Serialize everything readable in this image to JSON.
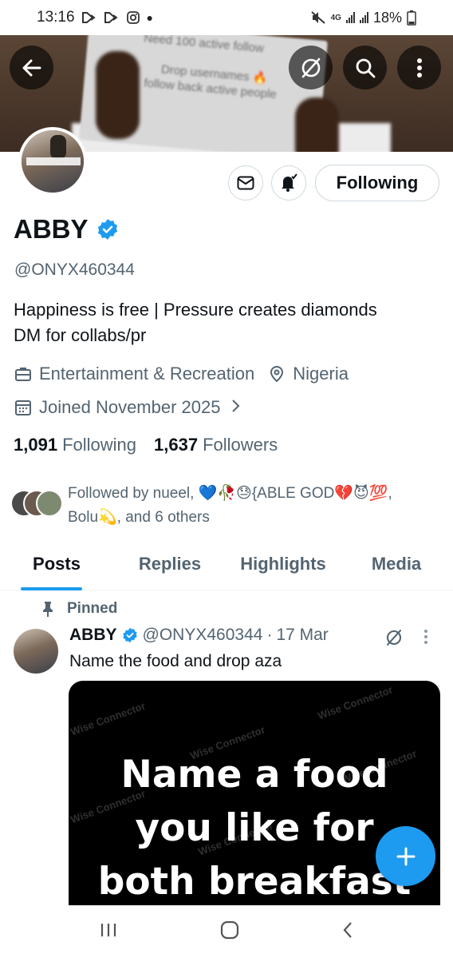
{
  "status_bar": {
    "time": "13:16",
    "battery": "18%",
    "network": "4G"
  },
  "banner": {
    "sign_line_1": "Need 100 active follow",
    "sign_line_2": "Drop usernames 🔥",
    "sign_line_3": "follow back active people"
  },
  "profile": {
    "display_name": "ABBY",
    "handle": "@ONYX460344",
    "bio_line_1": "Happiness is free | Pressure creates diamonds",
    "bio_line_2": "DM for collabs/pr",
    "category": "Entertainment & Recreation",
    "location": "Nigeria",
    "joined": "Joined November 2025",
    "following_count": "1,091",
    "following_label": "Following",
    "followers_count": "1,637",
    "followers_label": "Followers",
    "followed_by_line_1": "Followed by nueel, 💙🥀😓{ABLE GOD💔😈💯,",
    "followed_by_line_2": "Bolu💫, and 6 others",
    "following_button": "Following"
  },
  "tabs": [
    {
      "label": "Posts",
      "active": true
    },
    {
      "label": "Replies",
      "active": false
    },
    {
      "label": "Highlights",
      "active": false
    },
    {
      "label": "Media",
      "active": false
    }
  ],
  "post": {
    "pinned_label": "Pinned",
    "author_name": "ABBY",
    "author_handle": "@ONYX460344",
    "separator": "·",
    "date": "17 Mar",
    "text": "Name the food and drop aza",
    "media_line_1": "Name a food",
    "media_line_2": "you like for",
    "media_line_3": "both breakfast",
    "watermark": "Wise Connector"
  },
  "colors": {
    "accent": "#1d9bf0",
    "text_primary": "#0f1419",
    "text_secondary": "#536471",
    "border": "#cfd9de"
  },
  "icons": {
    "back": "arrow-left-icon",
    "grok": "grok-icon",
    "search": "search-icon",
    "more": "more-vertical-icon",
    "mail": "mail-icon",
    "bell": "bell-icon",
    "verified": "verified-badge-icon",
    "briefcase": "briefcase-icon",
    "location": "location-pin-icon",
    "calendar": "calendar-icon",
    "pin": "pin-icon",
    "compose": "plus-icon"
  }
}
